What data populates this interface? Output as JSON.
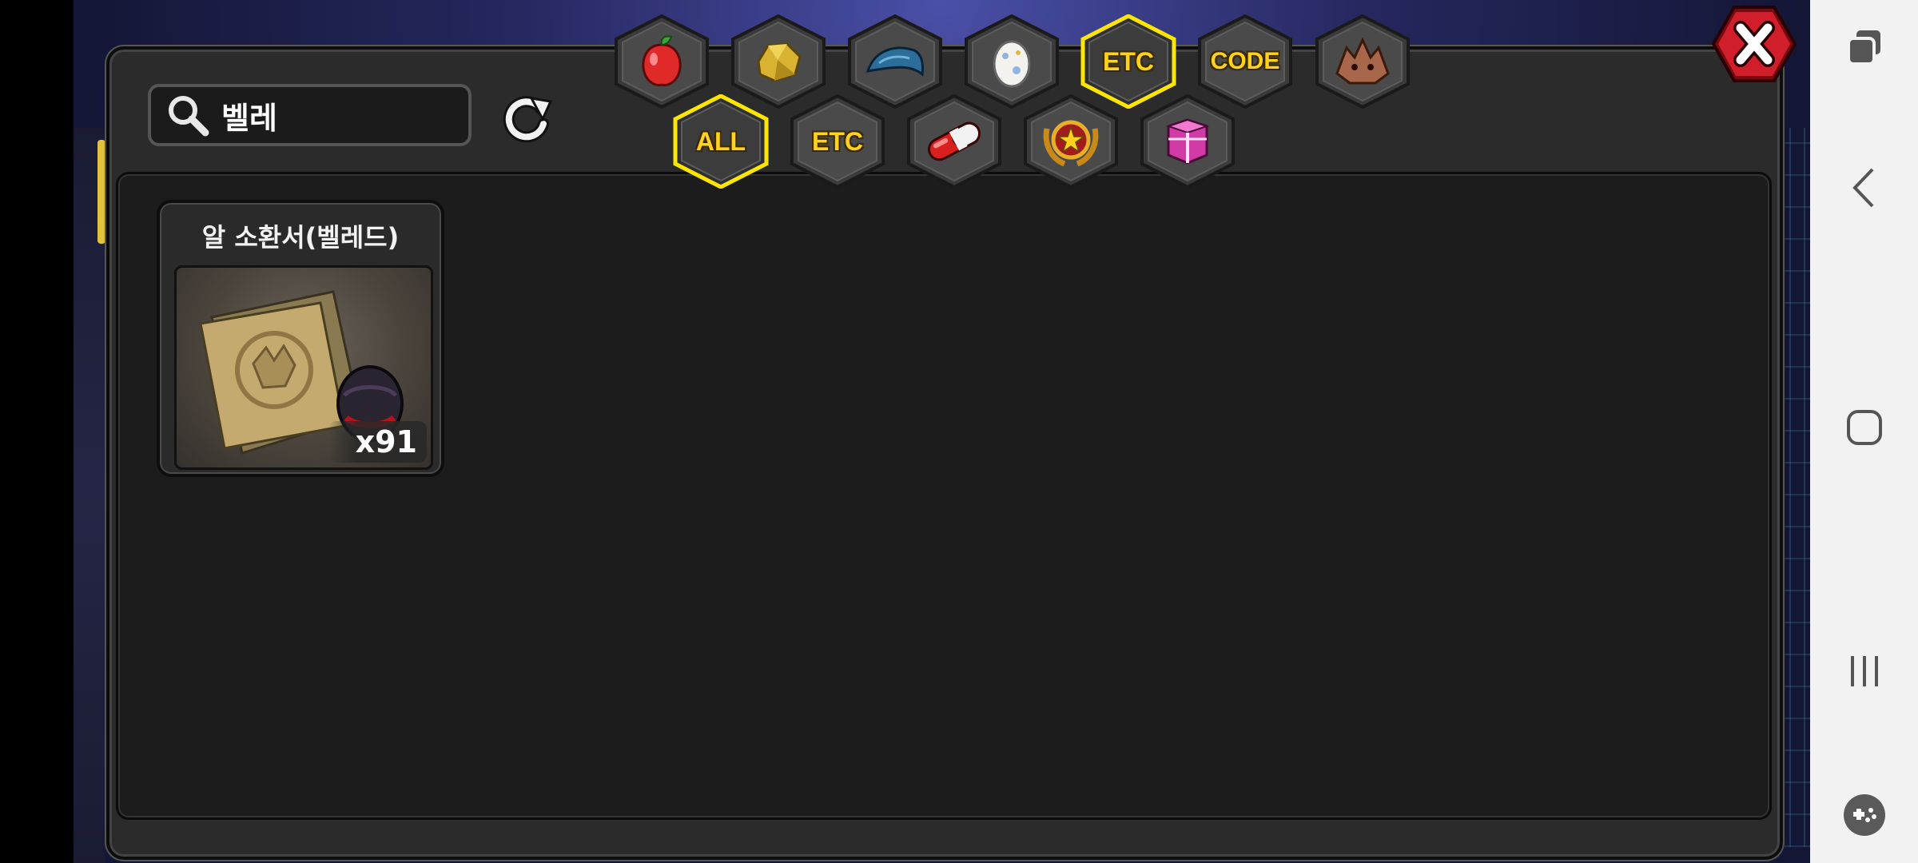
{
  "search": {
    "query": "벨레"
  },
  "category_tabs_top": [
    {
      "id": "fruit",
      "icon": "red-fruit-icon",
      "label": ""
    },
    {
      "id": "gold",
      "icon": "gold-ore-icon",
      "label": ""
    },
    {
      "id": "scale",
      "icon": "blue-scale-icon",
      "label": ""
    },
    {
      "id": "egg",
      "icon": "egg-icon",
      "label": ""
    },
    {
      "id": "etc",
      "icon": "",
      "label": "ETC",
      "selected": true
    },
    {
      "id": "code",
      "icon": "",
      "label": "CODE"
    },
    {
      "id": "monster",
      "icon": "dragon-head-icon",
      "label": ""
    }
  ],
  "category_tabs_bottom": [
    {
      "id": "all",
      "icon": "",
      "label": "ALL",
      "selected": true
    },
    {
      "id": "etc2",
      "icon": "",
      "label": "ETC"
    },
    {
      "id": "capsule",
      "icon": "red-capsule-icon",
      "label": ""
    },
    {
      "id": "medal",
      "icon": "star-medal-icon",
      "label": ""
    },
    {
      "id": "gift",
      "icon": "gift-box-icon",
      "label": ""
    }
  ],
  "items": [
    {
      "name": "알 소환서(벨레드)",
      "count": "x91",
      "icon": "summon-scroll-icon"
    }
  ],
  "colors": {
    "accent_yellow": "#ffd21f",
    "panel": "#2b2b2b",
    "content": "#1c1c1c",
    "close_red": "#d01f2a"
  }
}
